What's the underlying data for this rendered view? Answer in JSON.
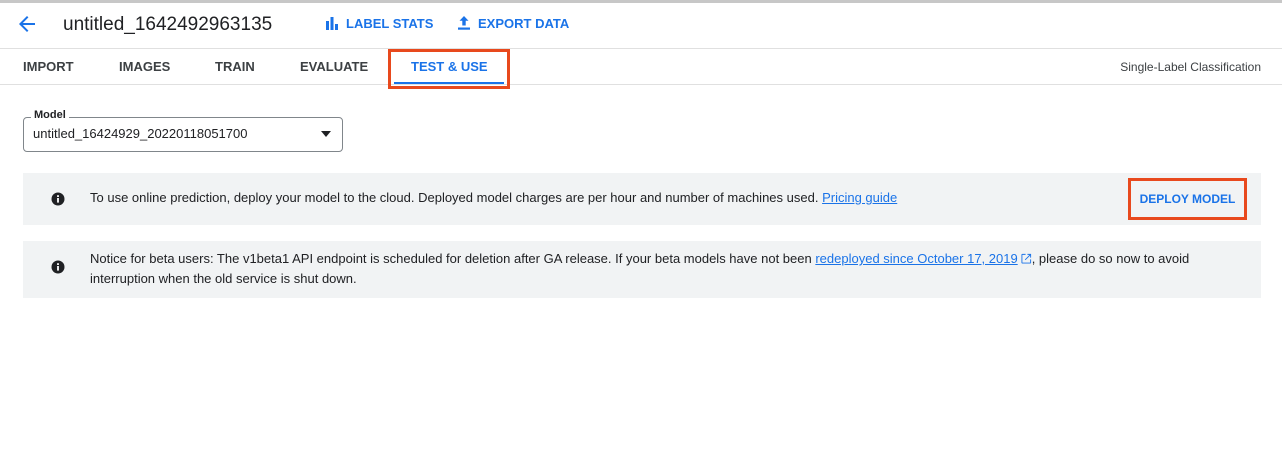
{
  "header": {
    "title": "untitled_1642492963135",
    "label_stats": "LABEL STATS",
    "export_data": "EXPORT DATA"
  },
  "tabs": [
    {
      "label": "IMPORT"
    },
    {
      "label": "IMAGES"
    },
    {
      "label": "TRAIN"
    },
    {
      "label": "EVALUATE"
    },
    {
      "label": "TEST & USE",
      "active": true
    }
  ],
  "mode_label": "Single-Label Classification",
  "model_field": {
    "label": "Model",
    "value": "untitled_16424929_20220118051700"
  },
  "banner_deploy": {
    "text": "To use online prediction, deploy your model to the cloud. Deployed model charges are per hour and number of machines used.",
    "link": "Pricing guide",
    "button": "DEPLOY MODEL"
  },
  "banner_notice": {
    "text_before": "Notice for beta users: The v1beta1 API endpoint is scheduled for deletion after GA release. If your beta models have not been",
    "link": "redeployed since October 17, 2019",
    "text_after": ", please do so now to avoid interruption when the old service is shut down."
  },
  "colors": {
    "accent": "#1a73e8",
    "highlight": "#e8491d",
    "banner_bg": "#f1f3f4"
  },
  "icons": [
    "back-arrow-icon",
    "bar-chart-icon",
    "upload-icon",
    "dropdown-caret-icon",
    "info-icon",
    "external-link-icon"
  ]
}
